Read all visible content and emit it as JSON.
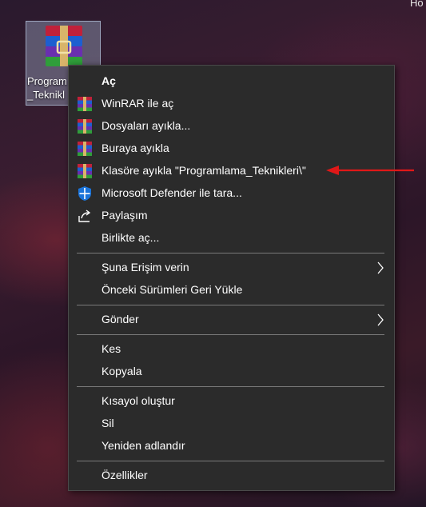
{
  "desktop": {
    "corner_text": "Ho",
    "icon": {
      "label": "Program\n_Teknikl"
    }
  },
  "menu": {
    "open": "Aç",
    "winrar_open": "WinRAR ile aç",
    "extract_files": "Dosyaları ayıkla...",
    "extract_here": "Buraya ayıkla",
    "extract_to_folder": "Klasöre ayıkla \"Programlama_Teknikleri\\\"",
    "defender_scan": "Microsoft Defender ile tara...",
    "share": "Paylaşım",
    "open_with": "Birlikte aç...",
    "give_access": "Şuna Erişim verin",
    "restore_versions": "Önceki Sürümleri Geri Yükle",
    "send_to": "Gönder",
    "cut": "Kes",
    "copy": "Kopyala",
    "create_shortcut": "Kısayol oluştur",
    "delete": "Sil",
    "rename": "Yeniden adlandır",
    "properties": "Özellikler"
  },
  "colors": {
    "menu_bg": "#2b2b2b",
    "annotation_arrow": "#e01818"
  }
}
